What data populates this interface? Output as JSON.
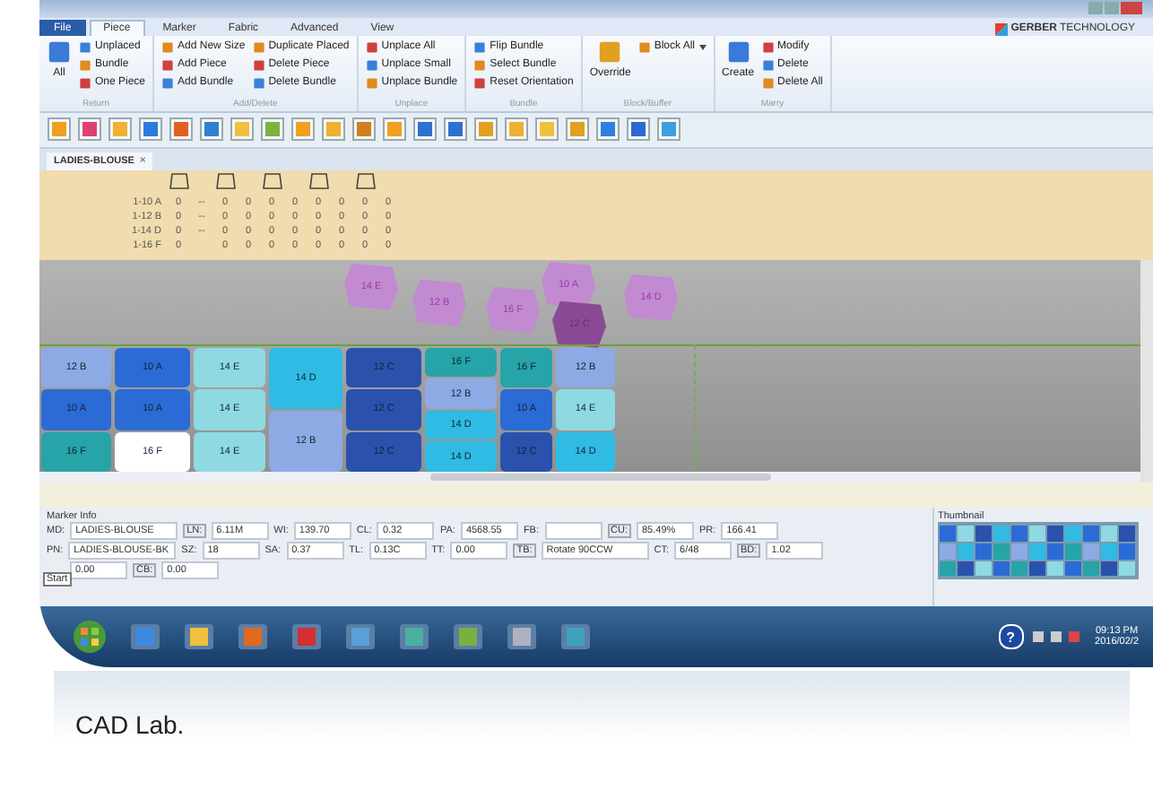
{
  "ribbon_tabs": [
    {
      "label": "File",
      "kind": "file",
      "selected": false
    },
    {
      "label": "Piece",
      "kind": "tab",
      "selected": true
    },
    {
      "label": "Marker",
      "kind": "tab",
      "selected": false
    },
    {
      "label": "Fabric",
      "kind": "tab",
      "selected": false
    },
    {
      "label": "Advanced",
      "kind": "tab",
      "selected": false
    },
    {
      "label": "View",
      "kind": "tab",
      "selected": false
    }
  ],
  "brand": "**GERBER** TECHNOLOGY",
  "ribbon_groups": [
    {
      "name": "Return",
      "big": "All",
      "items": [
        {
          "label": "Unplaced",
          "dropdown": false
        },
        {
          "label": "Bundle",
          "dropdown": false
        },
        {
          "label": "One Piece",
          "dropdown": false
        }
      ]
    },
    {
      "name": "Add/Delete",
      "items": [
        {
          "label": "Add New Size",
          "dropdown": false
        },
        {
          "label": "Add Piece",
          "dropdown": false
        },
        {
          "label": "Add Bundle",
          "dropdown": false
        },
        {
          "label": "Duplicate Placed",
          "dropdown": false
        },
        {
          "label": "Delete Piece",
          "dropdown": false
        },
        {
          "label": "Delete Bundle",
          "dropdown": false
        }
      ]
    },
    {
      "name": "Unplace",
      "items": [
        {
          "label": "Unplace All",
          "dropdown": false
        },
        {
          "label": "Unplace Small",
          "dropdown": false
        },
        {
          "label": "Unplace Bundle",
          "dropdown": false
        }
      ]
    },
    {
      "name": "Bundle",
      "items": [
        {
          "label": "Flip Bundle",
          "dropdown": false
        },
        {
          "label": "Select Bundle",
          "dropdown": false
        },
        {
          "label": "Reset Orientation",
          "dropdown": false
        }
      ]
    },
    {
      "name": "Block/Buffer",
      "big": "Override",
      "items": [
        {
          "label": "Block All",
          "dropdown": true
        }
      ]
    },
    {
      "name": "Marry",
      "big": "Create",
      "items": [
        {
          "label": "Modify",
          "dropdown": false
        },
        {
          "label": "Delete",
          "dropdown": false
        },
        {
          "label": "Delete All",
          "dropdown": false
        }
      ]
    }
  ],
  "doc_tab": {
    "label": "LADIES-BLOUSE",
    "close": "×"
  },
  "piece_table": {
    "rows": [
      {
        "label": "1-10",
        "size": "A",
        "cells": [
          "0",
          "--",
          "0",
          "0",
          "0",
          "0",
          "0",
          "0",
          "0",
          "0"
        ]
      },
      {
        "label": "1-12",
        "size": "B",
        "cells": [
          "0",
          "--",
          "0",
          "0",
          "0",
          "0",
          "0",
          "0",
          "0",
          "0"
        ]
      },
      {
        "label": "1-14",
        "size": "D",
        "cells": [
          "0",
          "--",
          "0",
          "0",
          "0",
          "0",
          "0",
          "0",
          "0",
          "0"
        ]
      },
      {
        "label": "1-16",
        "size": "F",
        "cells": [
          "0",
          null,
          "0",
          "0",
          "0",
          "0",
          "0",
          "0",
          "0",
          "0"
        ]
      }
    ]
  },
  "unplaced_pieces": [
    {
      "label": "14 E",
      "selected": false
    },
    {
      "label": "12 B",
      "selected": false
    },
    {
      "label": "16 F",
      "selected": false
    },
    {
      "label": "10 A",
      "selected": false
    },
    {
      "label": "12 C",
      "selected": true
    },
    {
      "label": "14 D",
      "selected": false
    }
  ],
  "placed_columns": [
    [
      {
        "label": "12 B",
        "color": "#8eaae4"
      },
      {
        "label": "10 A",
        "color": "#2b6bd6"
      },
      {
        "label": "16 F",
        "color": "#26a4a8"
      }
    ],
    [
      {
        "label": "10 A",
        "color": "#2b6bd6"
      },
      {
        "label": "10 A",
        "color": "#2b6bd6"
      },
      {
        "label": "16 F",
        "color": "#ffffff"
      }
    ],
    [
      {
        "label": "14 E",
        "color": "#8fd9e3"
      },
      {
        "label": "14 E",
        "color": "#8fd9e3"
      },
      {
        "label": "14 E",
        "color": "#8fd9e3"
      }
    ],
    [
      {
        "label": "14 D",
        "color": "#2fbbe3"
      },
      {
        "label": "12 B",
        "color": "#8eaae4"
      }
    ],
    [
      {
        "label": "12 C",
        "color": "#2a52ad"
      },
      {
        "label": "12 C",
        "color": "#2a52ad"
      },
      {
        "label": "12 C",
        "color": "#2a52ad"
      }
    ],
    [
      {
        "label": "16 F",
        "color": "#26a4a8"
      },
      {
        "label": "12 B",
        "color": "#8eaae4"
      },
      {
        "label": "14 D",
        "color": "#2fbbe3"
      },
      {
        "label": "14 D",
        "color": "#2fbbe3"
      }
    ],
    [
      {
        "label": "16 F",
        "color": "#26a4a8"
      },
      {
        "label": "10 A",
        "color": "#2b6bd6"
      },
      {
        "label": "12 C",
        "color": "#2a52ad"
      }
    ],
    [
      {
        "label": "12 B",
        "color": "#8eaae4"
      },
      {
        "label": "14 E",
        "color": "#8fd9e3"
      },
      {
        "label": "14 D",
        "color": "#2fbbe3"
      }
    ]
  ],
  "marker_info": {
    "title": "Marker Info",
    "rows": [
      [
        {
          "label": "MD:",
          "value": "LADIES-BLOUSE",
          "kind": "text"
        },
        {
          "label": "LN:",
          "value": "6.11M",
          "kind": "button"
        },
        {
          "label": "WI:",
          "value": "139.70",
          "kind": "text"
        },
        {
          "label": "CL:",
          "value": "0.32",
          "kind": "text"
        },
        {
          "label": "PA:",
          "value": "4568.55",
          "kind": "text"
        },
        {
          "label": "FB:",
          "kind": "text"
        },
        {
          "label": "CU:",
          "value": "85.49%",
          "kind": "button"
        },
        {
          "label": "PR:",
          "value": "166.41",
          "kind": "text"
        }
      ],
      [
        {
          "label": "PN:",
          "value": "LADIES-BLOUSE-BK",
          "kind": "text"
        },
        {
          "label": "SZ:",
          "value": "18",
          "kind": "text"
        },
        {
          "label": "SA:",
          "value": "0.37",
          "kind": "text"
        },
        {
          "label": "TL:",
          "value": "0.13C",
          "kind": "text"
        },
        {
          "label": "TT:",
          "value": "0.00",
          "kind": "text"
        },
        {
          "label": "TB:",
          "value": "Rotate 90CCW",
          "kind": "button"
        },
        {
          "label": "CT:",
          "value": "6/48",
          "kind": "text"
        },
        {
          "label": "BD:",
          "value": "1.02",
          "kind": "button"
        }
      ],
      [
        {
          "value": "0.00",
          "kind": "text"
        },
        {
          "label": "CB:",
          "value": "0.00",
          "kind": "button"
        }
      ]
    ],
    "tooltip": "Start"
  },
  "thumbnail": {
    "title": "Thumbnail"
  },
  "taskbar": {
    "clock": "09:13 PM",
    "date": "2016/02/2",
    "help": "?"
  },
  "caption": "CAD Lab."
}
